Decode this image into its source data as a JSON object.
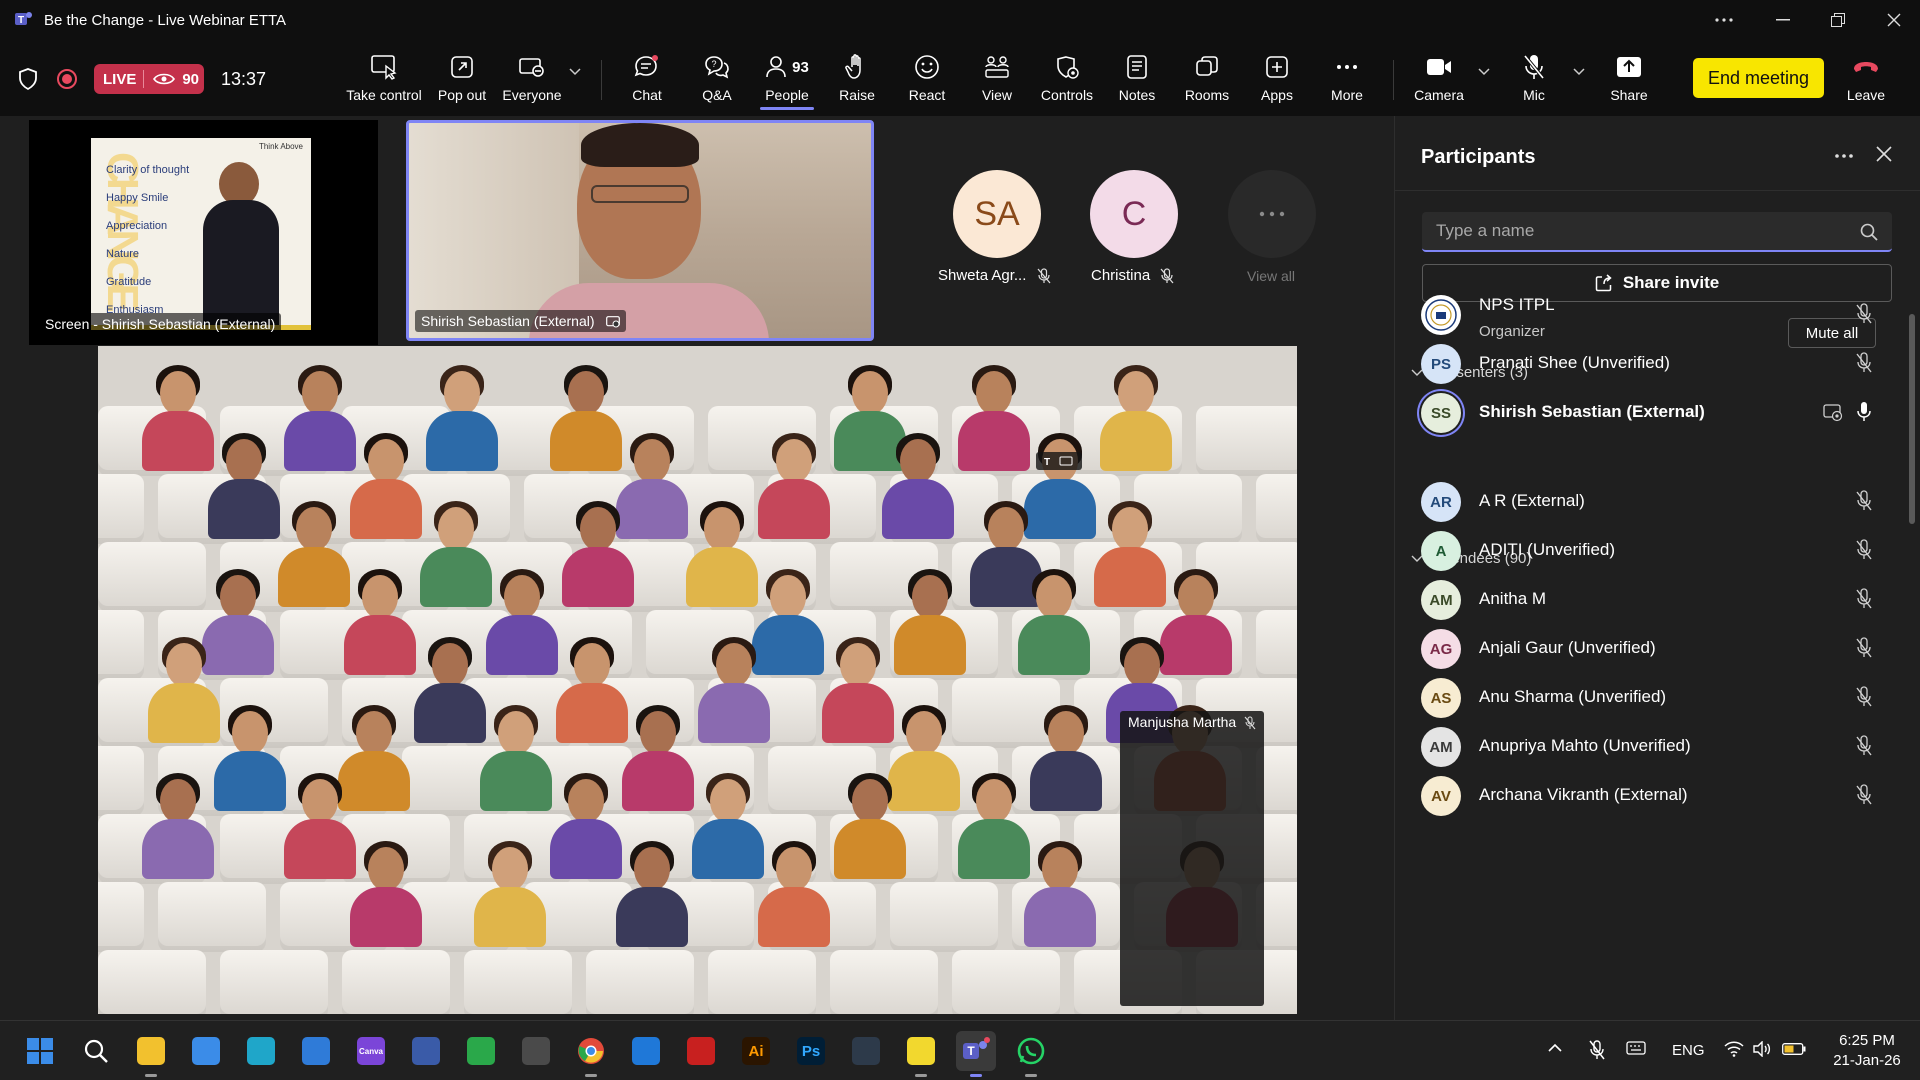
{
  "window": {
    "title": "Be the Change - Live Webinar ETTA"
  },
  "toolbar": {
    "live_label": "LIVE",
    "viewer_count": "90",
    "timer": "13:37",
    "take_control": "Take control",
    "pop_out": "Pop out",
    "everyone": "Everyone",
    "chat": "Chat",
    "qa": "Q&A",
    "people": "People",
    "people_count": "93",
    "raise": "Raise",
    "react": "React",
    "view": "View",
    "controls": "Controls",
    "notes": "Notes",
    "rooms": "Rooms",
    "apps": "Apps",
    "more": "More",
    "camera": "Camera",
    "mic": "Mic",
    "share": "Share",
    "end_meeting": "End meeting",
    "leave": "Leave",
    "accent": "#7f85f5",
    "end_color": "#f8e600",
    "leave_color": "#c4314b"
  },
  "stage": {
    "screen_tile_label": "Screen - Shirish Sebastian (External)",
    "slide": {
      "header": "Think Above",
      "lines": [
        "Clarity of thought",
        "Happy Smile",
        "Appreciation",
        "Nature",
        "Gratitude",
        "Enthusiasm"
      ],
      "vertical_word": "CHANGE"
    },
    "speaker_tile_label": "Shirish Sebastian (External)",
    "avatars": [
      {
        "initials": "SA",
        "name": "Shweta Agr...",
        "color": "#fbe8d5",
        "text_color": "#8a4a1a"
      },
      {
        "initials": "C",
        "name": "Christina",
        "color": "#f3dbe8",
        "text_color": "#7a2a55"
      }
    ],
    "view_all": "View all",
    "gallery_label": "Manjusha Martha"
  },
  "panel": {
    "title": "Participants",
    "search_placeholder": "Type a name",
    "share_invite": "Share invite",
    "presenters_header": "Presenters (3)",
    "mute_all": "Mute all",
    "presenters": [
      {
        "initials": "",
        "name": "NPS ITPL",
        "sub": "Organizer",
        "color": "#ffffff",
        "text_color": "#1a3a7a",
        "logo": true
      },
      {
        "initials": "PS",
        "name": "Pranati Shee (Unverified)",
        "sub": "",
        "color": "#d6e4f7",
        "text_color": "#234a7a"
      },
      {
        "initials": "SS",
        "name": "Shirish Sebastian (External)",
        "sub": "",
        "color": "#e6eedd",
        "text_color": "#3a4a28",
        "bold": true,
        "speaking": true
      }
    ],
    "attendees_header": "Attendees (90)",
    "attendees": [
      {
        "initials": "AR",
        "name": "A R (External)",
        "color": "#d6e4f7",
        "text_color": "#234a7a"
      },
      {
        "initials": "A",
        "name": "ADITI (Unverified)",
        "color": "#d8f0e0",
        "text_color": "#1e5a34"
      },
      {
        "initials": "AM",
        "name": "Anitha M",
        "color": "#e6eedd",
        "text_color": "#3a4a28"
      },
      {
        "initials": "AG",
        "name": "Anjali Gaur (Unverified)",
        "color": "#f5dde6",
        "text_color": "#7a2a48"
      },
      {
        "initials": "AS",
        "name": "Anu Sharma (Unverified)",
        "color": "#f7ecd2",
        "text_color": "#6a4a12"
      },
      {
        "initials": "AM",
        "name": "Anupriya Mahto (Unverified)",
        "color": "#e4e4e4",
        "text_color": "#3a3a3a"
      },
      {
        "initials": "AV",
        "name": "Archana Vikranth (External)",
        "color": "#f7ecd2",
        "text_color": "#6a4a12"
      }
    ]
  },
  "taskbar": {
    "apps": [
      {
        "name": "start",
        "color": "#3b8ce8"
      },
      {
        "name": "search",
        "color": "#202020"
      },
      {
        "name": "file-explorer",
        "color": "#f2c12e"
      },
      {
        "name": "microsoft-store",
        "color": "#3b8ce8"
      },
      {
        "name": "edge",
        "color": "#1fa6c9"
      },
      {
        "name": "todo",
        "color": "#2f7bd8"
      },
      {
        "name": "canva",
        "color": "#7b45d8"
      },
      {
        "name": "remote-desktop",
        "color": "#3a5ba8"
      },
      {
        "name": "anydesk",
        "color": "#2aa84a"
      },
      {
        "name": "sandbox",
        "color": "#4a4a4a"
      },
      {
        "name": "chrome",
        "color": "#e24a3a"
      },
      {
        "name": "wifi-app",
        "color": "#1f78d8"
      },
      {
        "name": "adobe-acrobat",
        "color": "#c8201f"
      },
      {
        "name": "illustrator",
        "color": "#2b1500"
      },
      {
        "name": "photoshop",
        "color": "#001e36"
      },
      {
        "name": "visio",
        "color": "#2d3a4a"
      },
      {
        "name": "sticky-notes",
        "color": "#f2d82e"
      },
      {
        "name": "teams",
        "color": "#5b5fc7"
      },
      {
        "name": "whatsapp",
        "color": "#25d366"
      }
    ],
    "illustrator_label": "Ai",
    "photoshop_label": "Ps",
    "canva_label": "Canva",
    "language": "ENG",
    "time": "6:25 PM",
    "date": "21-Jan-26"
  }
}
